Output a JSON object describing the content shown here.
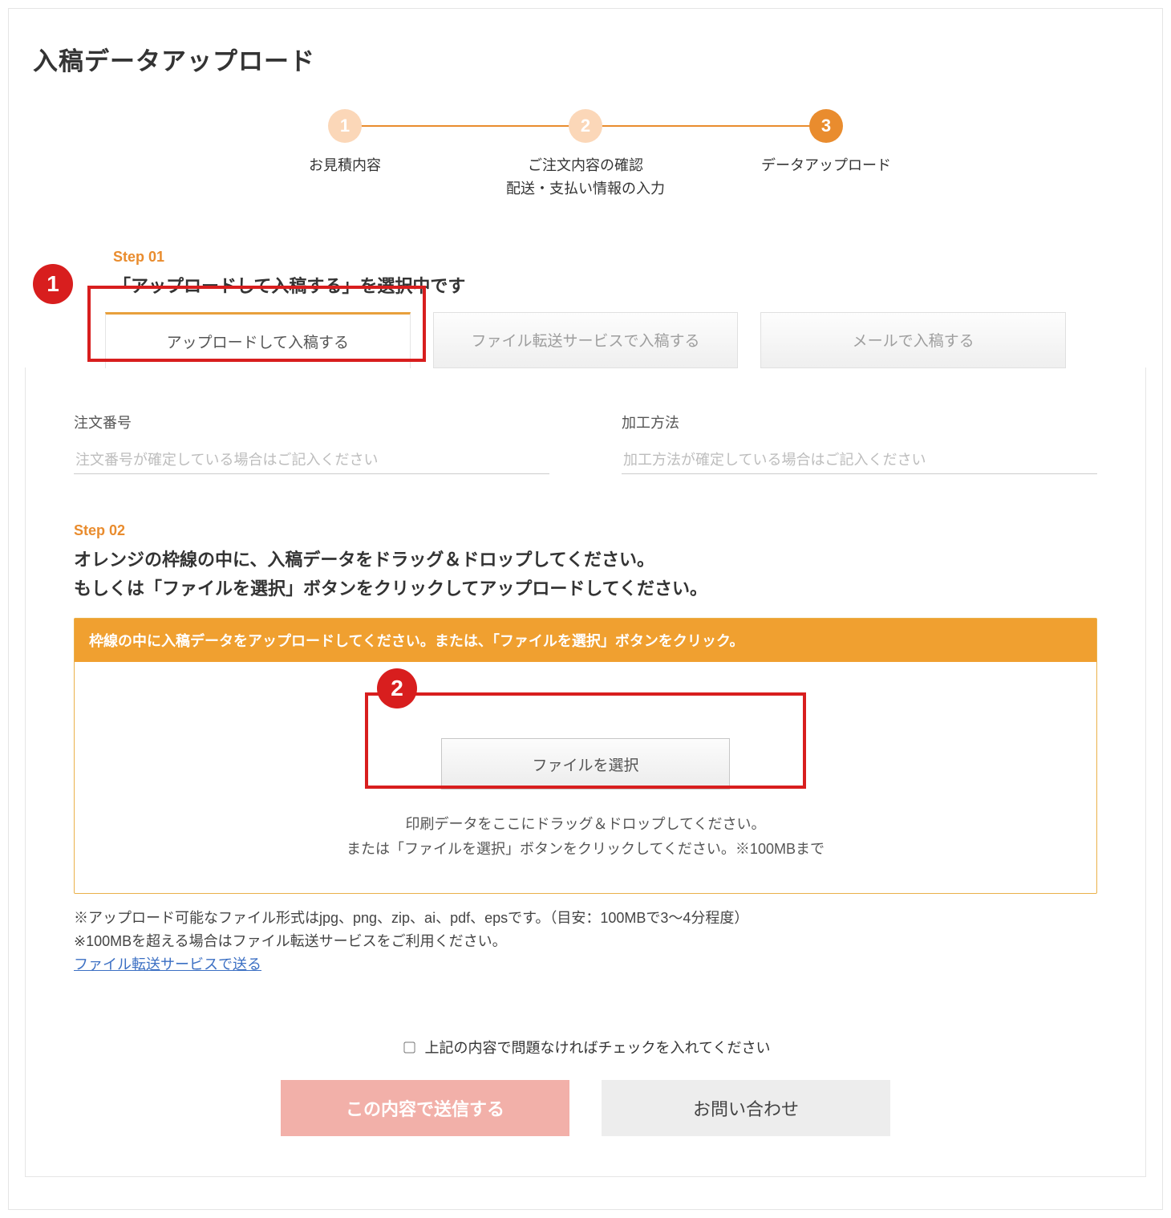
{
  "pageTitle": "入稿データアップロード",
  "progress": {
    "steps": [
      {
        "num": "1",
        "label": "お見積内容",
        "active": false
      },
      {
        "num": "2",
        "label": "ご注文内容の確認\n配送・支払い情報の入力",
        "active": false
      },
      {
        "num": "3",
        "label": "データアップロード",
        "active": true
      }
    ]
  },
  "annotations": {
    "badge1": "1",
    "badge2": "2"
  },
  "step01": {
    "label": "Step 01",
    "title": "「アップロードして入稿する」を選択中です",
    "tabs": [
      {
        "label": "アップロードして入稿する",
        "active": true
      },
      {
        "label": "ファイル転送サービスで入稿する",
        "active": false
      },
      {
        "label": "メールで入稿する",
        "active": false
      }
    ]
  },
  "form": {
    "orderNumber": {
      "label": "注文番号",
      "placeholder": "注文番号が確定している場合はご記入ください"
    },
    "processMethod": {
      "label": "加工方法",
      "placeholder": "加工方法が確定している場合はご記入ください"
    }
  },
  "step02": {
    "label": "Step 02",
    "descLine1": "オレンジの枠線の中に、入稿データをドラッグ＆ドロップしてください。",
    "descLine2": "もしくは「ファイルを選択」ボタンをクリックしてアップロードしてください。",
    "uploadHeader": "枠線の中に入稿データをアップロードしてください。または、「ファイルを選択」ボタンをクリック。",
    "fileSelectButton": "ファイルを選択",
    "helpLine1": "印刷データをここにドラッグ＆ドロップしてください。",
    "helpLine2": "または「ファイルを選択」ボタンをクリックしてください。※100MBまで"
  },
  "notes": {
    "line1": "※アップロード可能なファイル形式はjpg、png、zip、ai、pdf、epsです。（目安：100MBで3～4分程度）",
    "line2": "※100MBを超える場合はファイル転送サービスをご利用ください。",
    "link": "ファイル転送サービスで送る"
  },
  "confirm": {
    "label": "上記の内容で問題なければチェックを入れてください"
  },
  "buttons": {
    "submit": "この内容で送信する",
    "inquiry": "お問い合わせ"
  }
}
